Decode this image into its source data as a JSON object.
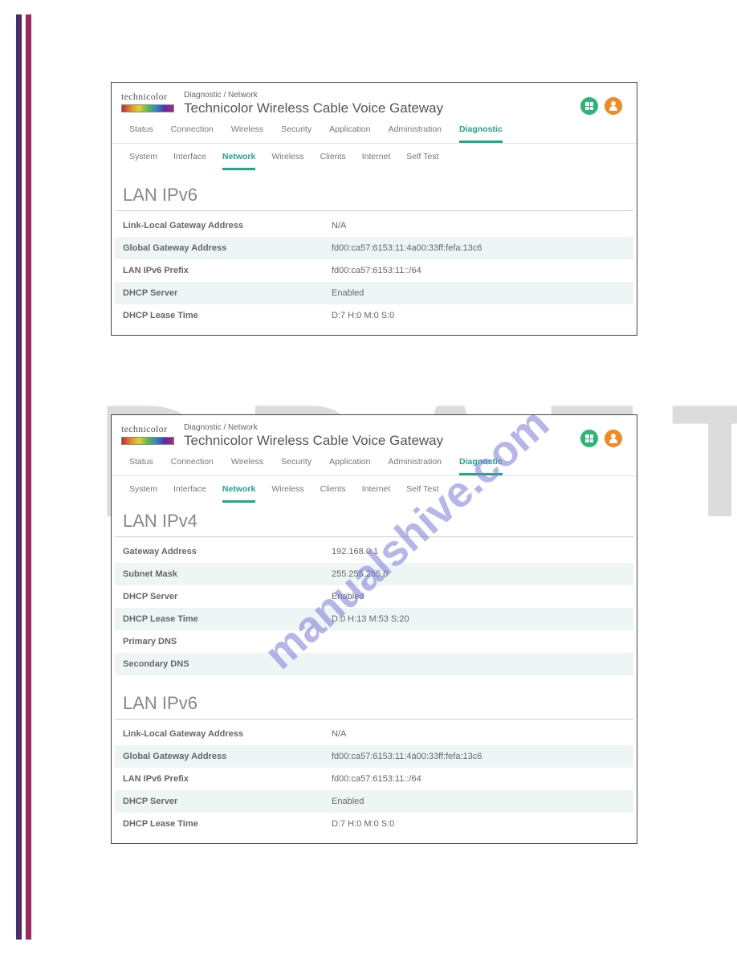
{
  "watermarks": {
    "draft": "DRAFT",
    "url": "manualshive.com"
  },
  "brand": "technicolor",
  "breadcrumb": "Diagnostic / Network",
  "title": "Technicolor Wireless Cable Voice Gateway",
  "primary_tabs": [
    "Status",
    "Connection",
    "Wireless",
    "Security",
    "Application",
    "Administration",
    "Diagnostic"
  ],
  "primary_active": "Diagnostic",
  "sub_tabs": [
    "System",
    "Interface",
    "Network",
    "Wireless",
    "Clients",
    "Internet",
    "Self Test"
  ],
  "sub_active": "Network",
  "panel1": {
    "section": "LAN IPv6",
    "rows": [
      {
        "k": "Link-Local Gateway Address",
        "v": "N/A"
      },
      {
        "k": "Global Gateway Address",
        "v": "fd00:ca57:6153:11:4a00:33ff:fefa:13c6"
      },
      {
        "k": "LAN IPv6 Prefix",
        "v": "fd00:ca57:6153:11::/64"
      },
      {
        "k": "DHCP Server",
        "v": "Enabled"
      },
      {
        "k": "DHCP Lease Time",
        "v": "D:7 H:0 M:0 S:0"
      }
    ]
  },
  "panel2": {
    "sectionA": "LAN IPv4",
    "rowsA": [
      {
        "k": "Gateway Address",
        "v": "192.168.0.1"
      },
      {
        "k": "Subnet Mask",
        "v": "255.255.255.0"
      },
      {
        "k": "DHCP Server",
        "v": "Enabled"
      },
      {
        "k": "DHCP Lease Time",
        "v": "D:0 H:13 M:53 S:20"
      },
      {
        "k": "Primary DNS",
        "v": ""
      },
      {
        "k": "Secondary DNS",
        "v": ""
      }
    ],
    "sectionB": "LAN IPv6",
    "rowsB": [
      {
        "k": "Link-Local Gateway Address",
        "v": "N/A"
      },
      {
        "k": "Global Gateway Address",
        "v": "fd00:ca57:6153:11:4a00:33ff:fefa:13c6"
      },
      {
        "k": "LAN IPv6 Prefix",
        "v": "fd00:ca57:6153:11::/64"
      },
      {
        "k": "DHCP Server",
        "v": "Enabled"
      },
      {
        "k": "DHCP Lease Time",
        "v": "D:7 H:0 M:0 S:0"
      }
    ]
  }
}
